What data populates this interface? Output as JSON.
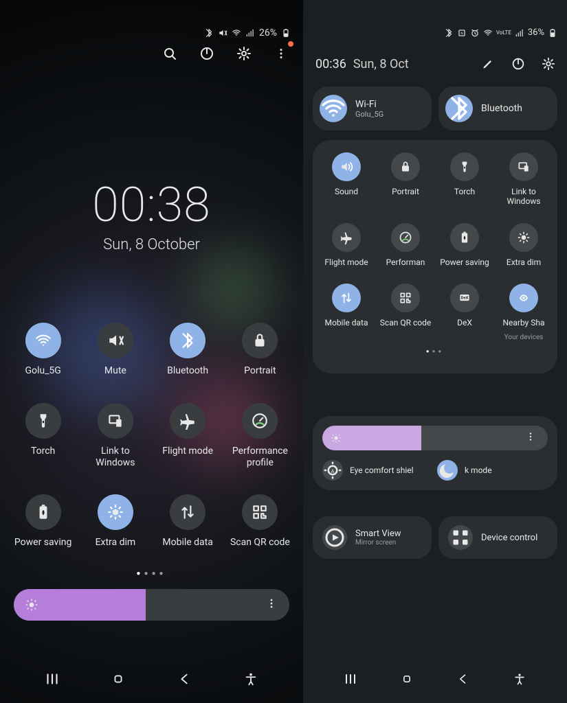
{
  "colors": {
    "accent_on": "#8fb3e6",
    "accent_brightness": "#b57fd9"
  },
  "left": {
    "status": {
      "battery": "26%",
      "battery_icon": "charging"
    },
    "clock_time": "00:38",
    "clock_date": "Sun, 8 October",
    "brightness_percent": 48,
    "tiles": [
      {
        "label": "Golu_5G",
        "icon": "wifi",
        "on": true
      },
      {
        "label": "Mute",
        "icon": "mute",
        "on": false
      },
      {
        "label": "Bluetooth",
        "icon": "bluetooth",
        "on": true
      },
      {
        "label": "Portrait",
        "icon": "lock",
        "on": false
      },
      {
        "label": "Torch",
        "icon": "torch",
        "on": false
      },
      {
        "label": "Link to Windows",
        "icon": "link-windows",
        "on": false
      },
      {
        "label": "Flight mode",
        "icon": "plane",
        "on": false
      },
      {
        "label": "Performance profile",
        "icon": "gauge",
        "on": false
      },
      {
        "label": "Power saving",
        "icon": "battery-leaf",
        "on": false
      },
      {
        "label": "Extra dim",
        "icon": "dim",
        "on": true
      },
      {
        "label": "Mobile data",
        "icon": "data-arrows",
        "on": false
      },
      {
        "label": "Scan QR code",
        "icon": "qr",
        "on": false
      }
    ],
    "pager": {
      "count": 4,
      "active": 0
    },
    "nav": [
      "recents",
      "home",
      "back",
      "accessibility"
    ]
  },
  "right": {
    "status": {
      "battery": "36%",
      "volte": "VoLTE"
    },
    "header": {
      "time": "00:36",
      "date": "Sun, 8 Oct"
    },
    "pills": [
      {
        "title": "Wi-Fi",
        "sub": "Golu_5G",
        "icon": "wifi",
        "on": true
      },
      {
        "title": "Bluetooth",
        "sub": "",
        "icon": "bluetooth",
        "on": true
      }
    ],
    "tiles": [
      {
        "label": "Sound",
        "icon": "sound",
        "on": true
      },
      {
        "label": "Portrait",
        "icon": "lock",
        "on": false
      },
      {
        "label": "Torch",
        "icon": "torch",
        "on": false
      },
      {
        "label": "Link to Windows",
        "icon": "link-windows",
        "on": false
      },
      {
        "label": "Flight mode",
        "icon": "plane",
        "on": false
      },
      {
        "label": "Performan",
        "icon": "gauge",
        "on": false
      },
      {
        "label": "Power saving",
        "icon": "battery-leaf",
        "on": false
      },
      {
        "label": "Extra dim",
        "icon": "dim",
        "on": false
      },
      {
        "label": "Mobile data",
        "icon": "data-arrows",
        "on": true
      },
      {
        "label": "Scan QR code",
        "icon": "qr",
        "on": false
      },
      {
        "label": "DeX",
        "icon": "dex",
        "on": false
      },
      {
        "label": "Nearby Sha",
        "sub": "Your devices",
        "icon": "nearby",
        "on": true
      }
    ],
    "pager": {
      "count": 3,
      "active": 0
    },
    "brightness_percent": 44,
    "toggles": [
      {
        "label": "Eye comfort shiel",
        "icon": "eye-comfort",
        "on": false
      },
      {
        "label": "k mode",
        "icon": "moon",
        "on": true
      }
    ],
    "lower": [
      {
        "title": "Smart View",
        "sub": "Mirror screen",
        "icon": "smartview"
      },
      {
        "title": "Device control",
        "icon": "grid4"
      }
    ],
    "nav": [
      "recents",
      "home",
      "back",
      "accessibility"
    ]
  }
}
